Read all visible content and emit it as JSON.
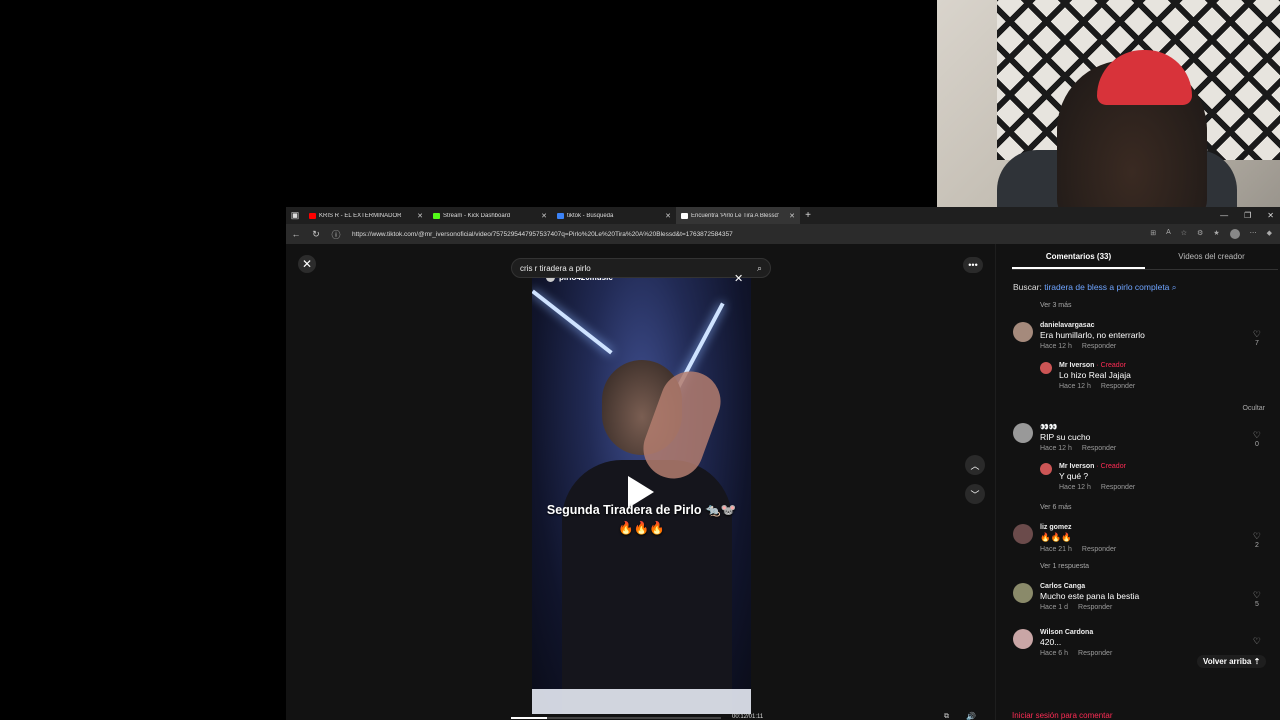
{
  "browser": {
    "tabs": [
      {
        "label": "KRIS R - EL EXTERMINADOR",
        "fav": "#ff0000",
        "active": false
      },
      {
        "label": "Stream - Kick Dashboard",
        "fav": "#53fc18",
        "active": false
      },
      {
        "label": "tiktok - Búsqueda",
        "fav": "#3b82f6",
        "active": false
      },
      {
        "label": "Encuentra 'Pirlo Le Tira A Blessd'",
        "fav": "#ffffff",
        "active": true
      }
    ],
    "url": "https://www.tiktok.com/@mr_iversonoficial/video/7575295447957537407q=Pirlo%20Le%20Tira%20A%20Blessd&t=1763872584357"
  },
  "player": {
    "search_query": "cris r tiradera a pirlo",
    "creator_handle": "pirlo420music",
    "caption_line1": "Segunda Tiradera de Pirlo 🐀🐭",
    "caption_line2": "🔥🔥🔥",
    "time": "00:12/01:11",
    "progress": 0.17
  },
  "panel": {
    "tab_comments": "Comentarios (33)",
    "tab_creator_videos": "Videos del creador",
    "search_prefix": "Buscar:",
    "search_term": "tiradera de bless a pirlo completa",
    "back_to_top": "Volver arriba",
    "login_prompt": "Iniciar sesión para comentar",
    "reply_label": "Responder",
    "creator_label": "· Creador",
    "hide_label": "Ocultar",
    "comments": [
      {
        "id": "c0",
        "more": "Ver 3 más"
      },
      {
        "id": "c1",
        "user": "danielavargasac",
        "text": "Era humillarlo, no enterrarlo",
        "time": "Hace 12 h",
        "likes": "7",
        "reply": {
          "user": "Mr Iverson",
          "text": "Lo hizo Real Jajaja",
          "time": "Hace 12 h",
          "likes": "1"
        }
      },
      {
        "id": "c2",
        "user": "👀👀",
        "text": "RIP su cucho",
        "time": "Hace 12 h",
        "likes": "0",
        "reply": {
          "user": "Mr Iverson",
          "text": "Y qué ?",
          "time": "Hace 12 h",
          "likes": "0"
        },
        "more": "Ver 6 más"
      },
      {
        "id": "c3",
        "user": "liz gomez",
        "text": "🔥🔥🔥",
        "time": "Hace 21 h",
        "likes": "2",
        "more": "Ver 1 respuesta"
      },
      {
        "id": "c4",
        "user": "Carlos Canga",
        "text": "Mucho este pana la bestia",
        "time": "Hace 1 d",
        "likes": "5"
      },
      {
        "id": "c5",
        "user": "Wilson Cardona",
        "text": "420...",
        "time": "Hace 6 h",
        "likes": ""
      }
    ]
  }
}
